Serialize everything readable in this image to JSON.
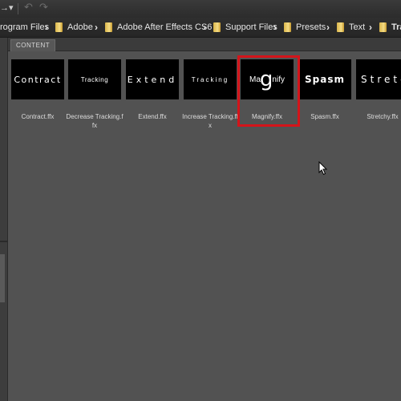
{
  "toolbar": {
    "menu_arrow": "→▾",
    "back_icon": "↶",
    "forward_icon": "↷"
  },
  "breadcrumb": [
    {
      "label": "rogram Files"
    },
    {
      "label": "Adobe"
    },
    {
      "label": "Adobe After Effects CS6"
    },
    {
      "label": "Support Files"
    },
    {
      "label": "Presets"
    },
    {
      "label": "Text"
    },
    {
      "label": "Tra"
    }
  ],
  "breadcrumb_separator": "›",
  "content": {
    "tab_label": "CONTENT",
    "items": [
      {
        "preview": "Contract",
        "file": "Contract.ffx"
      },
      {
        "preview": "Tracking",
        "file": "Decrease Tracking.ffx"
      },
      {
        "preview": "Extend",
        "file": "Extend.ffx"
      },
      {
        "preview": "Tracking",
        "file": "Increase Tracking.ffx"
      },
      {
        "preview_left": "Ma",
        "preview_big": "g",
        "preview_right": "nify",
        "file": "Magnify.ffx",
        "selected": true
      },
      {
        "preview": "Spasm",
        "file": "Spasm.ffx"
      },
      {
        "preview": "Stretch",
        "file": "Stretchy.ffx"
      }
    ]
  },
  "colors": {
    "selection_border": "#d4141a",
    "folder_icon": "#e8c45e",
    "panel_background": "#525252"
  }
}
